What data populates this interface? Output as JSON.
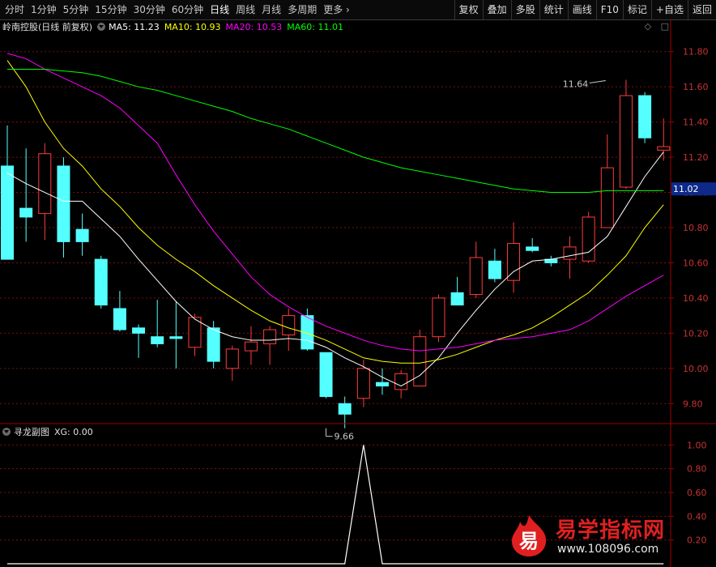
{
  "toolbar": {
    "tabs": [
      "分时",
      "1分钟",
      "5分钟",
      "15分钟",
      "30分钟",
      "60分钟",
      "日线",
      "周线",
      "月线",
      "多周期"
    ],
    "more_label": "更多",
    "right_buttons": [
      "复权",
      "叠加",
      "多股",
      "统计",
      "画线",
      "F10",
      "标记",
      "+自选",
      "返回"
    ]
  },
  "info": {
    "stock": "岭南控股(日线 前复权)",
    "ma5": "MA5: 11.23",
    "ma10": "MA10: 10.93",
    "ma20": "MA20: 10.53",
    "ma60": "MA60: 11.01"
  },
  "sub": {
    "title": "寻龙副图",
    "xg": "XG: 0.00"
  },
  "colors": {
    "up": "#ff3c3c",
    "down": "#54ffff",
    "ma5": "#ffffff",
    "ma10": "#ffff00",
    "ma20": "#ff00ff",
    "ma60": "#00ff00",
    "grid": "#7a1010",
    "axis": "#a00000",
    "tick": "#c83232"
  },
  "chart_data": [
    {
      "type": "candlestick",
      "y_ticks": [
        9.8,
        10.0,
        10.2,
        10.4,
        10.6,
        10.8,
        11.0,
        11.2,
        11.4,
        11.6,
        11.8
      ],
      "ylim": [
        9.7,
        11.9
      ],
      "current_price": "11.02",
      "annotations": [
        {
          "label": "11.64",
          "index": 32,
          "value": 11.64
        },
        {
          "label": "9.66",
          "index": 17,
          "value": 9.66
        }
      ],
      "candles": [
        {
          "o": 11.15,
          "h": 11.38,
          "l": 10.62,
          "c": 10.62
        },
        {
          "o": 10.91,
          "h": 11.25,
          "l": 10.72,
          "c": 10.86
        },
        {
          "o": 10.88,
          "h": 11.28,
          "l": 10.73,
          "c": 11.22
        },
        {
          "o": 11.15,
          "h": 11.2,
          "l": 10.63,
          "c": 10.72
        },
        {
          "o": 10.79,
          "h": 10.88,
          "l": 10.64,
          "c": 10.72
        },
        {
          "o": 10.62,
          "h": 10.64,
          "l": 10.34,
          "c": 10.36
        },
        {
          "o": 10.34,
          "h": 10.44,
          "l": 10.21,
          "c": 10.22
        },
        {
          "o": 10.23,
          "h": 10.25,
          "l": 10.06,
          "c": 10.2
        },
        {
          "o": 10.18,
          "h": 10.39,
          "l": 10.12,
          "c": 10.14
        },
        {
          "o": 10.18,
          "h": 10.38,
          "l": 10.0,
          "c": 10.17
        },
        {
          "o": 10.12,
          "h": 10.31,
          "l": 10.07,
          "c": 10.29
        },
        {
          "o": 10.23,
          "h": 10.27,
          "l": 10.0,
          "c": 10.04
        },
        {
          "o": 10.0,
          "h": 10.13,
          "l": 9.93,
          "c": 10.11
        },
        {
          "o": 10.1,
          "h": 10.24,
          "l": 10.02,
          "c": 10.15
        },
        {
          "o": 10.14,
          "h": 10.24,
          "l": 10.02,
          "c": 10.22
        },
        {
          "o": 10.19,
          "h": 10.34,
          "l": 10.1,
          "c": 10.3
        },
        {
          "o": 10.3,
          "h": 10.34,
          "l": 10.1,
          "c": 10.11
        },
        {
          "o": 10.09,
          "h": 10.09,
          "l": 9.83,
          "c": 9.84
        },
        {
          "o": 9.8,
          "h": 9.84,
          "l": 9.66,
          "c": 9.74
        },
        {
          "o": 9.83,
          "h": 10.05,
          "l": 9.78,
          "c": 10.0
        },
        {
          "o": 9.92,
          "h": 10.0,
          "l": 9.85,
          "c": 9.9
        },
        {
          "o": 9.88,
          "h": 9.99,
          "l": 9.83,
          "c": 9.97
        },
        {
          "o": 9.9,
          "h": 10.22,
          "l": 9.9,
          "c": 10.18
        },
        {
          "o": 10.18,
          "h": 10.42,
          "l": 10.15,
          "c": 10.4
        },
        {
          "o": 10.43,
          "h": 10.52,
          "l": 10.36,
          "c": 10.36
        },
        {
          "o": 10.42,
          "h": 10.72,
          "l": 10.4,
          "c": 10.63
        },
        {
          "o": 10.61,
          "h": 10.68,
          "l": 10.49,
          "c": 10.51
        },
        {
          "o": 10.5,
          "h": 10.83,
          "l": 10.43,
          "c": 10.71
        },
        {
          "o": 10.69,
          "h": 10.74,
          "l": 10.66,
          "c": 10.67
        },
        {
          "o": 10.62,
          "h": 10.64,
          "l": 10.58,
          "c": 10.6
        },
        {
          "o": 10.62,
          "h": 10.75,
          "l": 10.51,
          "c": 10.69
        },
        {
          "o": 10.61,
          "h": 10.89,
          "l": 10.6,
          "c": 10.86
        },
        {
          "o": 10.8,
          "h": 11.33,
          "l": 10.8,
          "c": 11.14
        },
        {
          "o": 11.03,
          "h": 11.64,
          "l": 11.02,
          "c": 11.55
        },
        {
          "o": 11.55,
          "h": 11.57,
          "l": 11.28,
          "c": 11.31
        },
        {
          "o": 11.24,
          "h": 11.42,
          "l": 11.18,
          "c": 11.26
        }
      ],
      "series": [
        {
          "name": "MA5",
          "values": [
            11.11,
            11.05,
            11.0,
            10.95,
            10.95,
            10.85,
            10.75,
            10.62,
            10.5,
            10.38,
            10.28,
            10.22,
            10.18,
            10.16,
            10.16,
            10.17,
            10.16,
            10.12,
            10.06,
            10.01,
            9.95,
            9.9,
            9.96,
            10.06,
            10.2,
            10.33,
            10.45,
            10.55,
            10.61,
            10.62,
            10.64,
            10.66,
            10.75,
            10.92,
            11.09,
            11.23
          ]
        },
        {
          "name": "MA10",
          "values": [
            11.75,
            11.6,
            11.4,
            11.25,
            11.15,
            11.02,
            10.92,
            10.8,
            10.7,
            10.62,
            10.55,
            10.47,
            10.4,
            10.33,
            10.27,
            10.23,
            10.2,
            10.16,
            10.11,
            10.06,
            10.04,
            10.03,
            10.03,
            10.05,
            10.08,
            10.12,
            10.16,
            10.19,
            10.23,
            10.29,
            10.36,
            10.43,
            10.53,
            10.64,
            10.8,
            10.93
          ]
        },
        {
          "name": "MA20",
          "values": [
            11.79,
            11.76,
            11.7,
            11.65,
            11.6,
            11.55,
            11.48,
            11.38,
            11.28,
            11.1,
            10.93,
            10.78,
            10.65,
            10.52,
            10.42,
            10.35,
            10.29,
            10.24,
            10.2,
            10.16,
            10.13,
            10.11,
            10.1,
            10.11,
            10.12,
            10.14,
            10.16,
            10.17,
            10.18,
            10.2,
            10.22,
            10.27,
            10.34,
            10.41,
            10.47,
            10.53
          ]
        },
        {
          "name": "MA60",
          "values": [
            11.7,
            11.7,
            11.7,
            11.69,
            11.68,
            11.66,
            11.63,
            11.6,
            11.58,
            11.55,
            11.52,
            11.49,
            11.46,
            11.42,
            11.39,
            11.36,
            11.32,
            11.28,
            11.24,
            11.2,
            11.17,
            11.14,
            11.12,
            11.1,
            11.08,
            11.06,
            11.04,
            11.02,
            11.01,
            11.0,
            11.0,
            11.0,
            11.01,
            11.01,
            11.01,
            11.01
          ]
        }
      ]
    },
    {
      "type": "line",
      "name": "XG",
      "y_ticks": [
        0.2,
        0.4,
        0.6,
        0.8,
        1.0
      ],
      "ylim": [
        0,
        1.05
      ],
      "values": [
        0,
        0,
        0,
        0,
        0,
        0,
        0,
        0,
        0,
        0,
        0,
        0,
        0,
        0,
        0,
        0,
        0,
        0,
        0,
        1,
        0,
        0,
        0,
        0,
        0,
        0,
        0,
        0,
        0,
        0,
        0,
        0,
        0,
        0,
        0,
        0
      ]
    }
  ],
  "watermark": {
    "logo_char": "易",
    "text": "易学指标网",
    "url": "www.108096.com"
  }
}
